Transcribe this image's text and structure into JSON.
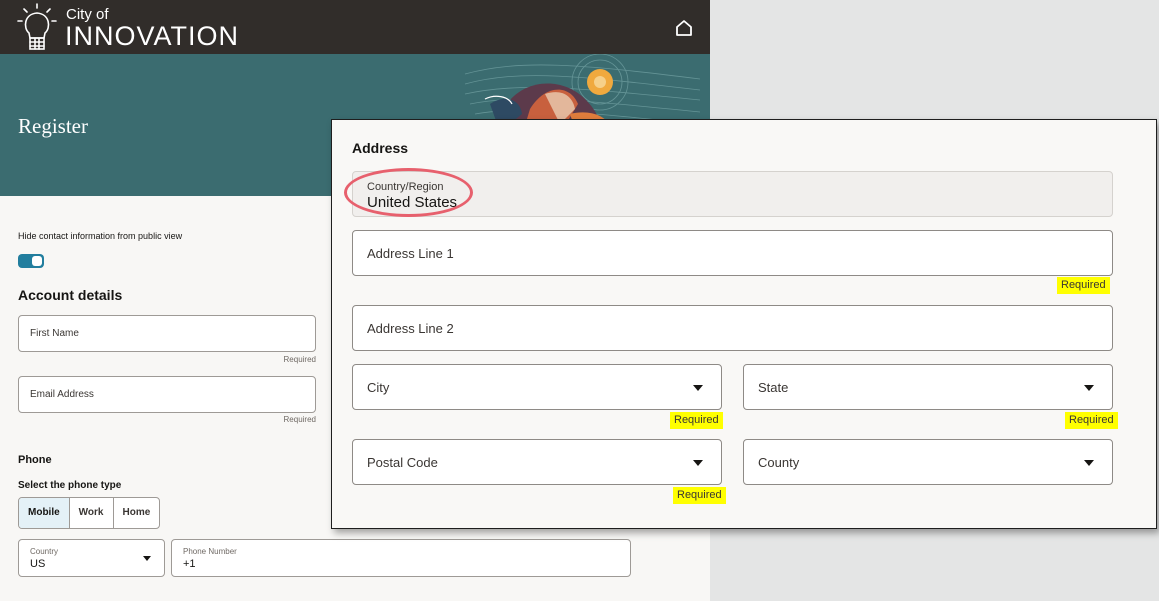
{
  "header": {
    "logo_small": "City of",
    "logo_big": "INNOVATION",
    "home_icon": "home-icon"
  },
  "banner": {
    "title": "Register"
  },
  "form": {
    "hide_contact_label": "Hide contact information from public view",
    "hide_contact_toggle": "on",
    "account_details_title": "Account details",
    "first_name_placeholder": "First Name",
    "first_name_hint": "Required",
    "email_placeholder": "Email Address",
    "email_hint": "Required",
    "phone_title": "Phone",
    "phone_type_label": "Select the phone type",
    "phone_types": [
      "Mobile",
      "Work",
      "Home"
    ],
    "phone_type_selected": "Mobile",
    "country_label": "Country",
    "country_value": "US",
    "phone_number_label": "Phone Number",
    "phone_number_value": "+1"
  },
  "address": {
    "title": "Address",
    "country_label": "Country/Region",
    "country_value": "United States",
    "line1_placeholder": "Address Line 1",
    "line1_hint": "Required",
    "line2_placeholder": "Address Line 2",
    "city_placeholder": "City",
    "city_hint": "Required",
    "state_placeholder": "State",
    "state_hint": "Required",
    "postal_placeholder": "Postal Code",
    "postal_hint": "Required",
    "county_placeholder": "County"
  },
  "colors": {
    "topbar": "#312d2a",
    "banner": "#3b6c70",
    "toggle_on": "#227e9e",
    "callout": "#e7606d",
    "highlight": "#ffff00"
  }
}
